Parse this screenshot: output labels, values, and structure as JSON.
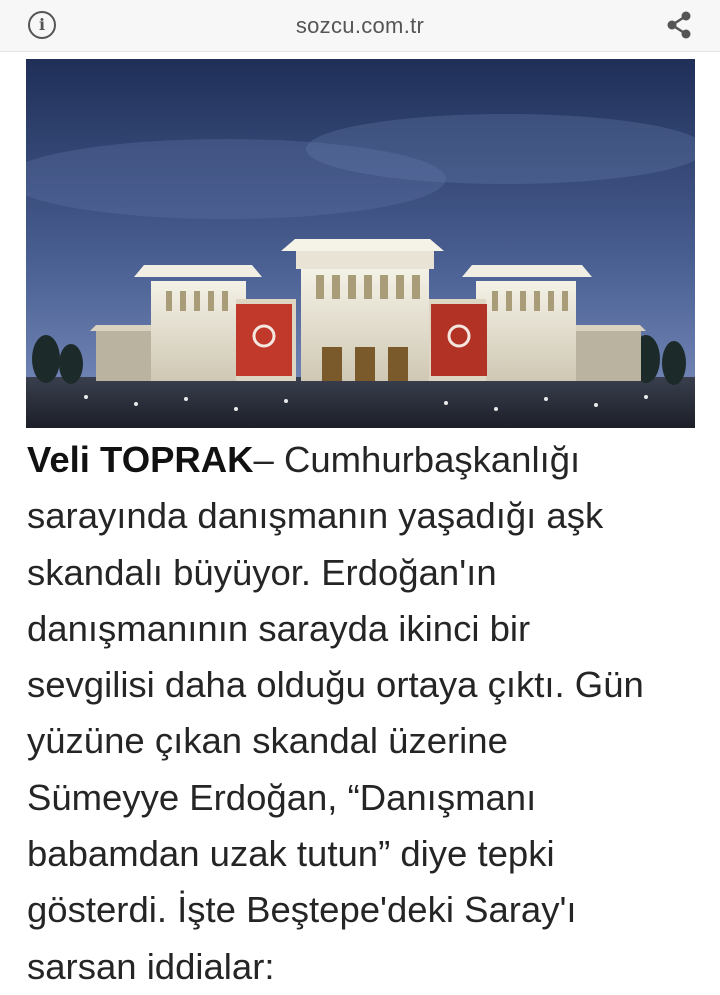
{
  "browser": {
    "url": "sozcu.com.tr",
    "info_icon": "info-icon",
    "share_icon": "share-icon"
  },
  "article": {
    "author": "Veli TOPRAK",
    "lead_lines": [
      "– Cumhurbaşkanlığı",
      "sarayında danışmanın yaşadığı aşk",
      "skandalı büyüyor. Erdoğan'ın",
      "danışmanının sarayda ikinci bir",
      "sevgilisi daha olduğu ortaya çıktı. Gün",
      "yüzüne çıkan skandal üzerine",
      "Sümeyye Erdoğan, “Danışmanı",
      "babamdan uzak tutun” diye tepki",
      "gösterdi. İşte Beştepe'deki Saray'ı",
      "sarsan iddialar:"
    ]
  },
  "colors": {
    "sky_top": "#1f2f58",
    "sky_bottom": "#6f86b8",
    "building": "#e9e6dc",
    "flag_red": "#c0392b"
  }
}
